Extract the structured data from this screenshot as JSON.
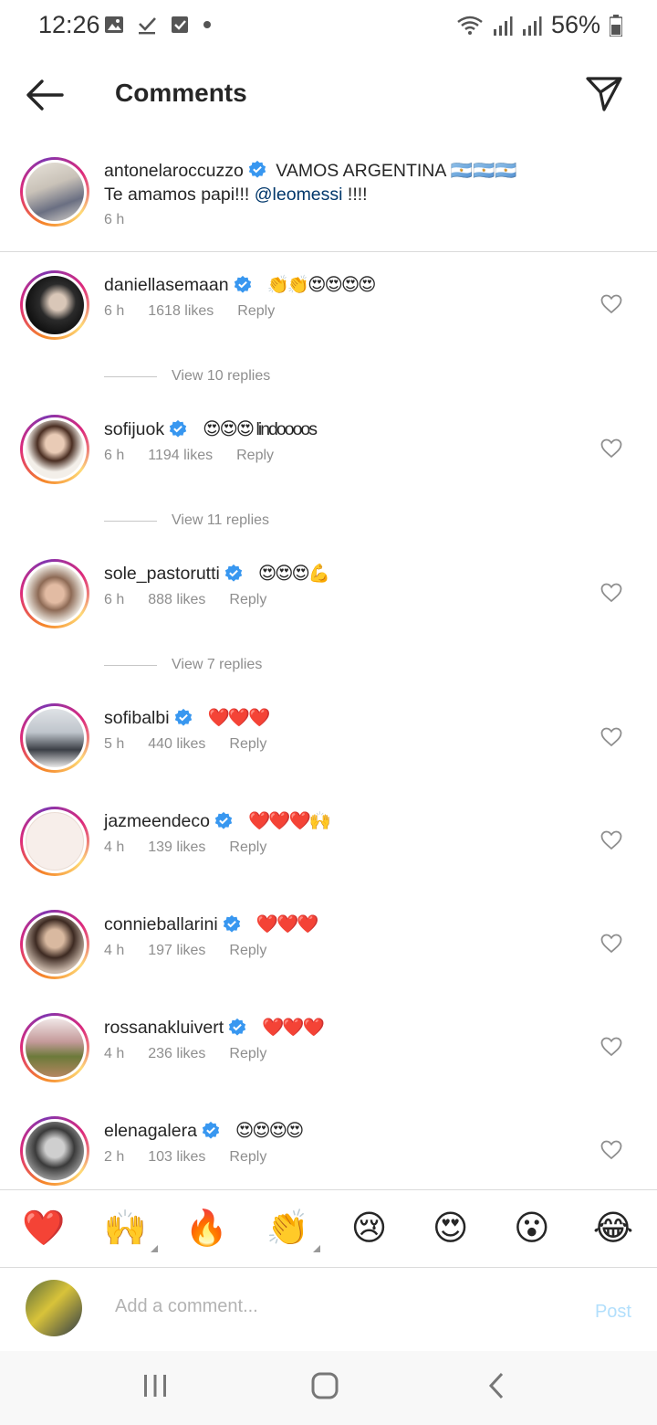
{
  "status_bar": {
    "time": "12:26",
    "battery": "56%"
  },
  "header": {
    "title": "Comments"
  },
  "caption": {
    "username": "antonelaroccuzzo",
    "text_line1": "VAMOS ARGENTINA 🇦🇷🇦🇷🇦🇷",
    "text_line2_prefix": "Te amamos papi!!!",
    "mention": "@leomessi",
    "text_line2_suffix": "!!!!",
    "time": "6 h"
  },
  "comments": [
    {
      "username": "daniellasemaan",
      "text": "👏👏😍😍😍😍",
      "time": "6 h",
      "likes": "1618 likes",
      "reply": "Reply",
      "view_replies": "View 10 replies"
    },
    {
      "username": "sofijuok",
      "text": "😍😍😍 lindoooos",
      "time": "6 h",
      "likes": "1194 likes",
      "reply": "Reply",
      "view_replies": "View 11 replies"
    },
    {
      "username": "sole_pastorutti",
      "text": "😍😍😍💪",
      "time": "6 h",
      "likes": "888 likes",
      "reply": "Reply",
      "view_replies": "View 7 replies"
    },
    {
      "username": "sofibalbi",
      "text": "❤️❤️❤️",
      "time": "5 h",
      "likes": "440 likes",
      "reply": "Reply"
    },
    {
      "username": "jazmeendeco",
      "text": "❤️❤️❤️🙌",
      "time": "4 h",
      "likes": "139 likes",
      "reply": "Reply"
    },
    {
      "username": "connieballarini",
      "text": "❤️❤️❤️",
      "time": "4 h",
      "likes": "197 likes",
      "reply": "Reply"
    },
    {
      "username": "rossanakluivert",
      "text": "❤️❤️❤️",
      "time": "4 h",
      "likes": "236 likes",
      "reply": "Reply"
    },
    {
      "username": "elenagalera",
      "text": "😍😍😍😍",
      "time": "2 h",
      "likes": "103 likes",
      "reply": "Reply"
    }
  ],
  "emoji_bar": [
    "❤️",
    "🙌",
    "🔥",
    "👏",
    "😢",
    "😍",
    "😮",
    "😂"
  ],
  "composer": {
    "placeholder": "Add a comment...",
    "post_label": "Post"
  },
  "colors": {
    "text": "#262626",
    "secondary": "#8e8e8e",
    "mention": "#00376b",
    "verified": "#3897f0",
    "post_disabled": "#b2dffc"
  },
  "icons": {
    "back": "arrow-left-icon",
    "send": "paper-plane-icon",
    "like": "heart-outline-icon",
    "verified": "verified-badge-icon"
  }
}
